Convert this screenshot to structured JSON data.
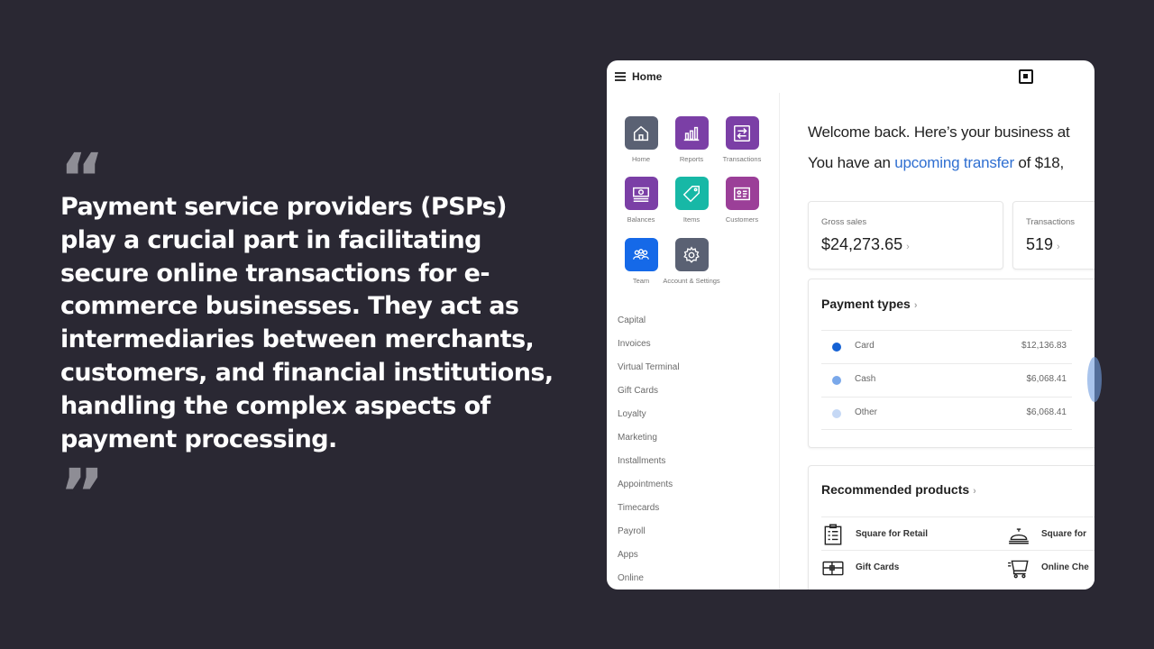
{
  "quote": {
    "open_mark": "“",
    "text": "Payment service providers (PSPs) play a crucial part in facilitating secure online transactions for e-commerce businesses. They act as intermediaries between merchants, customers, and financial institutions, handling the complex aspects of payment processing.",
    "close_mark": "”"
  },
  "app": {
    "title": "Home",
    "logo_icon": "square-logo-icon",
    "tiles": [
      {
        "label": "Home",
        "icon": "home-icon",
        "color": "#5a6173"
      },
      {
        "label": "Reports",
        "icon": "bar-chart-icon",
        "color": "#7b3fa6"
      },
      {
        "label": "Transactions",
        "icon": "transfer-arrows-icon",
        "color": "#7b3fa6"
      },
      {
        "label": "Balances",
        "icon": "cash-icon",
        "color": "#7b3fa6"
      },
      {
        "label": "Items",
        "icon": "tag-icon",
        "color": "#17b8a6"
      },
      {
        "label": "Customers",
        "icon": "id-card-icon",
        "color": "#9b3f98"
      },
      {
        "label": "Team",
        "icon": "team-icon",
        "color": "#1569e8"
      },
      {
        "label": "Account & Settings",
        "icon": "gear-icon",
        "color": "#5a6173"
      }
    ],
    "nav": [
      "Capital",
      "Invoices",
      "Virtual Terminal",
      "Gift Cards",
      "Loyalty",
      "Marketing",
      "Installments",
      "Appointments",
      "Timecards",
      "Payroll",
      "Apps",
      "Online"
    ],
    "welcome": "Welcome back. Here’s your business at",
    "transfer_prefix": "You have an ",
    "transfer_link": "upcoming transfer",
    "transfer_suffix": " of $18,",
    "stats": [
      {
        "label": "Gross sales",
        "value": "$24,273.65"
      },
      {
        "label": "Transactions",
        "value": "519"
      }
    ],
    "payment_types": {
      "title": "Payment types",
      "rows": [
        {
          "name": "Card",
          "amount": "$12,136.83",
          "color": "#1461d4"
        },
        {
          "name": "Cash",
          "amount": "$6,068.41",
          "color": "#7aa8ea"
        },
        {
          "name": "Other",
          "amount": "$6,068.41",
          "color": "#c5d8f5"
        }
      ]
    },
    "recommended": {
      "title": "Recommended products",
      "items": [
        {
          "label": "Square for Retail",
          "icon": "clipboard-icon"
        },
        {
          "label": "Square for",
          "icon": "service-bell-icon"
        },
        {
          "label": "Gift Cards",
          "icon": "gift-card-icon"
        },
        {
          "label": "Online Che",
          "icon": "shopping-cart-icon"
        }
      ]
    },
    "chevron": "›"
  }
}
